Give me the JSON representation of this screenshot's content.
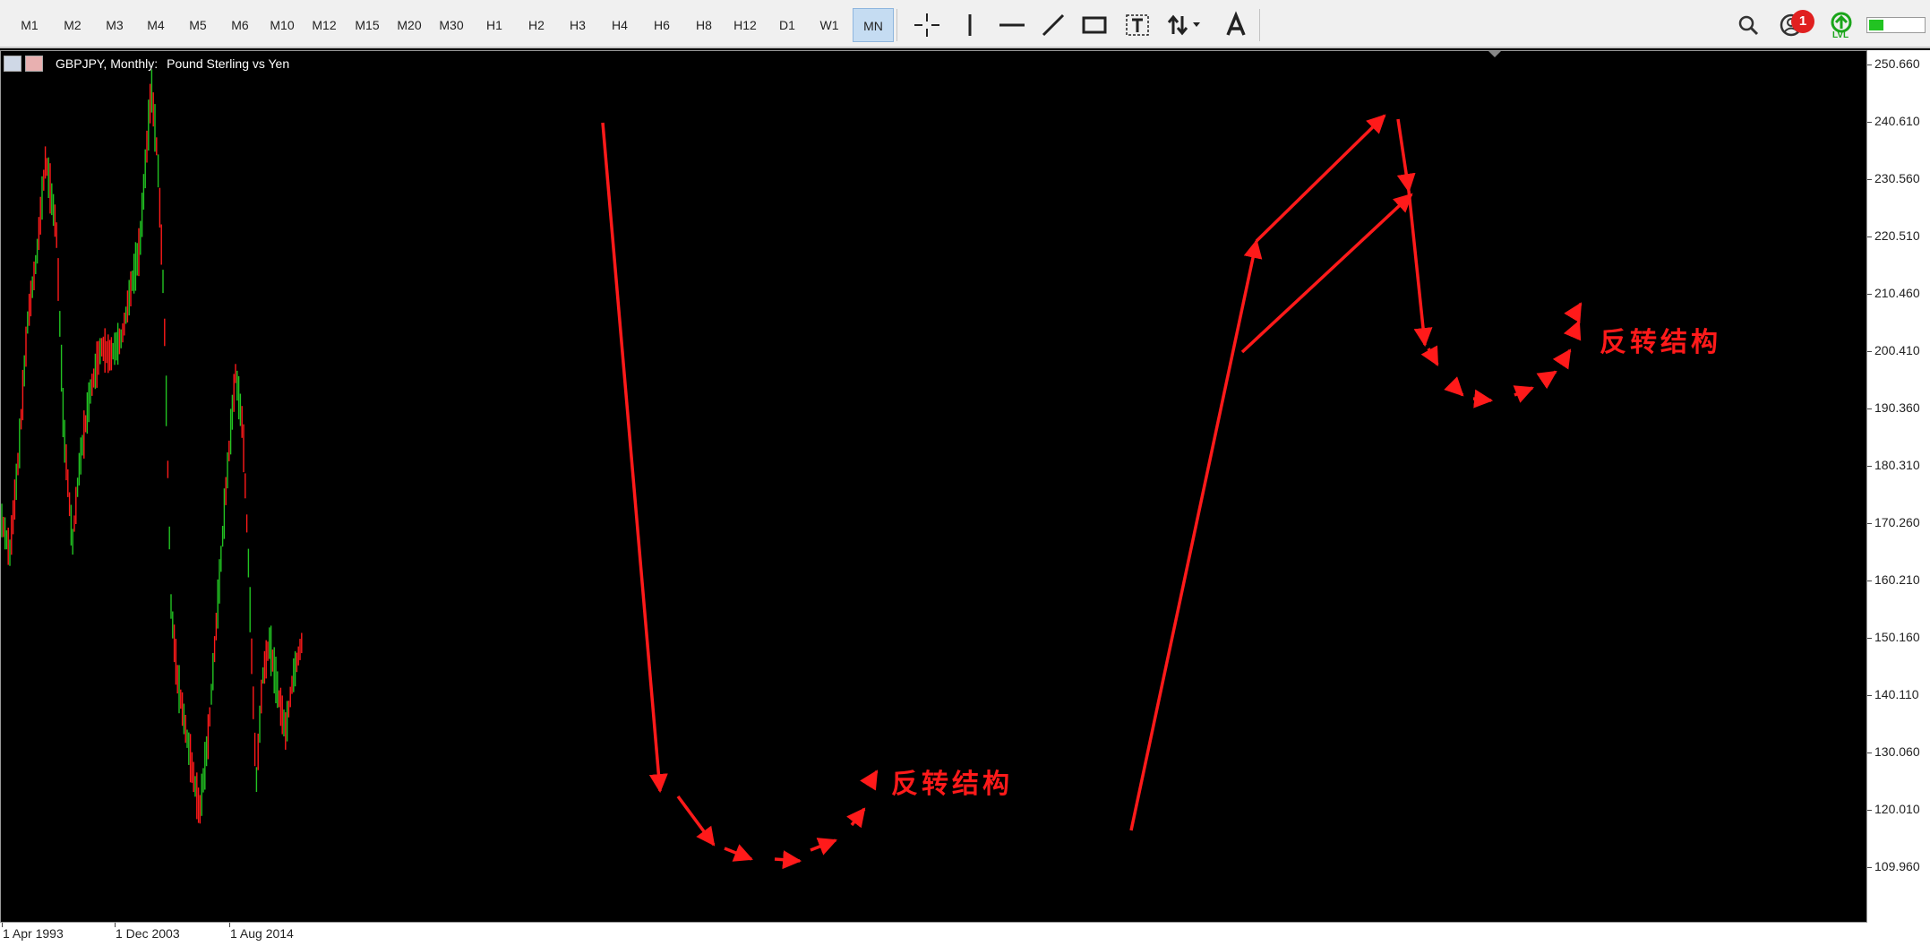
{
  "toolbar": {
    "timeframes": [
      {
        "label": "M1"
      },
      {
        "label": "M2"
      },
      {
        "label": "M3"
      },
      {
        "label": "M4"
      },
      {
        "label": "M5"
      },
      {
        "label": "M6"
      },
      {
        "label": "M10"
      },
      {
        "label": "M12"
      },
      {
        "label": "M15"
      },
      {
        "label": "M20"
      },
      {
        "label": "M30"
      },
      {
        "label": "H1"
      },
      {
        "label": "H2"
      },
      {
        "label": "H3"
      },
      {
        "label": "H4"
      },
      {
        "label": "H6"
      },
      {
        "label": "H8"
      },
      {
        "label": "H12"
      },
      {
        "label": "D1"
      },
      {
        "label": "W1"
      },
      {
        "label": "MN"
      }
    ],
    "active_timeframe": "MN",
    "tools": [
      "crosshair-icon",
      "vertical-line-icon",
      "horizontal-line-icon",
      "trendline-icon",
      "rectangle-icon",
      "text-label-icon",
      "arrows-icon",
      "text-icon"
    ],
    "notification_count": "1",
    "lvl_label": "LVL"
  },
  "chart": {
    "symbol": "GBPJPY, Monthly:",
    "description": "Pound Sterling vs Yen",
    "price_labels": [
      "250.660",
      "240.610",
      "230.560",
      "220.510",
      "210.460",
      "200.410",
      "190.360",
      "180.310",
      "170.260",
      "160.210",
      "150.160",
      "140.110",
      "130.060",
      "120.010",
      "109.960"
    ],
    "time_labels": [
      "1 Apr 1993",
      "1 Dec 2003",
      "1 Aug 2014"
    ],
    "annotations": [
      {
        "text": "反转结构"
      },
      {
        "text": "反转结构"
      }
    ],
    "colors": {
      "bull": "#22c322",
      "bear": "#ff1a1a",
      "annotation": "#ff1a1a",
      "background": "#000000"
    }
  }
}
